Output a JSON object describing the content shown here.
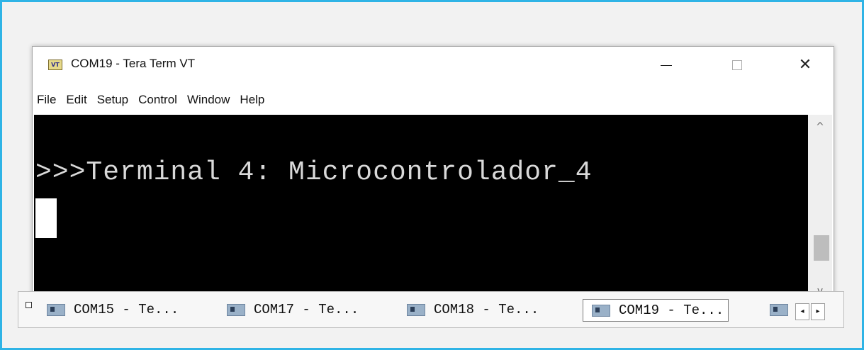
{
  "window": {
    "icon_text": "VT",
    "title": "COM19 - Tera Term VT",
    "minimize_glyph": "",
    "maximize_glyph": "",
    "close_glyph": "✕"
  },
  "menu": [
    "File",
    "Edit",
    "Setup",
    "Control",
    "Window",
    "Help"
  ],
  "terminal": {
    "line": ">>>Terminal 4: Microcontrolador_4"
  },
  "scrollbar": {
    "up_glyph": "^",
    "down_glyph": "v"
  },
  "taskbar": {
    "tabs": [
      {
        "label": "COM15 - Te..."
      },
      {
        "label": "COM17 - Te..."
      },
      {
        "label": "COM18 - Te..."
      },
      {
        "label": "COM19 - Te...",
        "active": true
      }
    ],
    "scroll_left": "◂",
    "scroll_right": "▸"
  },
  "colors": {
    "frame_border": "#2fb4e6",
    "terminal_bg": "#000000",
    "terminal_fg": "#d9d9d9"
  }
}
